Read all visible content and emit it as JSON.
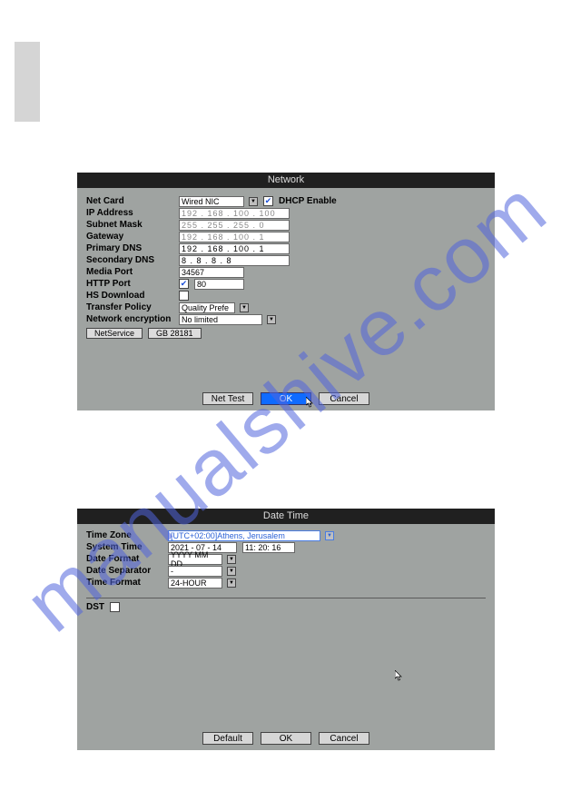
{
  "network": {
    "title": "Network",
    "labels": {
      "netcard": "Net Card",
      "ip": "IP Address",
      "subnet": "Subnet Mask",
      "gateway": "Gateway",
      "pdns": "Primary DNS",
      "sdns": "Secondary DNS",
      "mport": "Media Port",
      "hport": "HTTP Port",
      "hs": "HS Download",
      "tpolicy": "Transfer Policy",
      "nenc": "Network encryption"
    },
    "netcard": "Wired NIC",
    "dhcp_label": "DHCP Enable",
    "ip": "192 . 168 . 100 . 100",
    "subnet": "255 . 255 . 255 .   0",
    "gateway": "192 . 168 . 100 .   1",
    "pdns": "192 . 168 . 100 .   1",
    "sdns": "  8 .   8 .   8 .   8",
    "mport": "34567",
    "hport": "80",
    "tpolicy": "Quality Prefe",
    "nenc": "No limited",
    "netservice_btn": "NetService",
    "gb_btn": "GB 28181",
    "nettest_btn": "Net Test",
    "ok_btn": "OK",
    "cancel_btn": "Cancel"
  },
  "datetime": {
    "title": "Date Time",
    "labels": {
      "tz": "Time Zone",
      "systime": "System Time",
      "dformat": "Date Format",
      "dsep": "Date Separator",
      "tformat": "Time Format",
      "dst": "DST"
    },
    "tz": "[UTC+02:00]Athens, Jerusalem",
    "date": "2021 - 07 - 14",
    "time": "11: 20: 16",
    "dformat": "YYYY MM DD",
    "dsep": "-",
    "tformat": "24-HOUR",
    "default_btn": "Default",
    "ok_btn": "OK",
    "cancel_btn": "Cancel"
  }
}
